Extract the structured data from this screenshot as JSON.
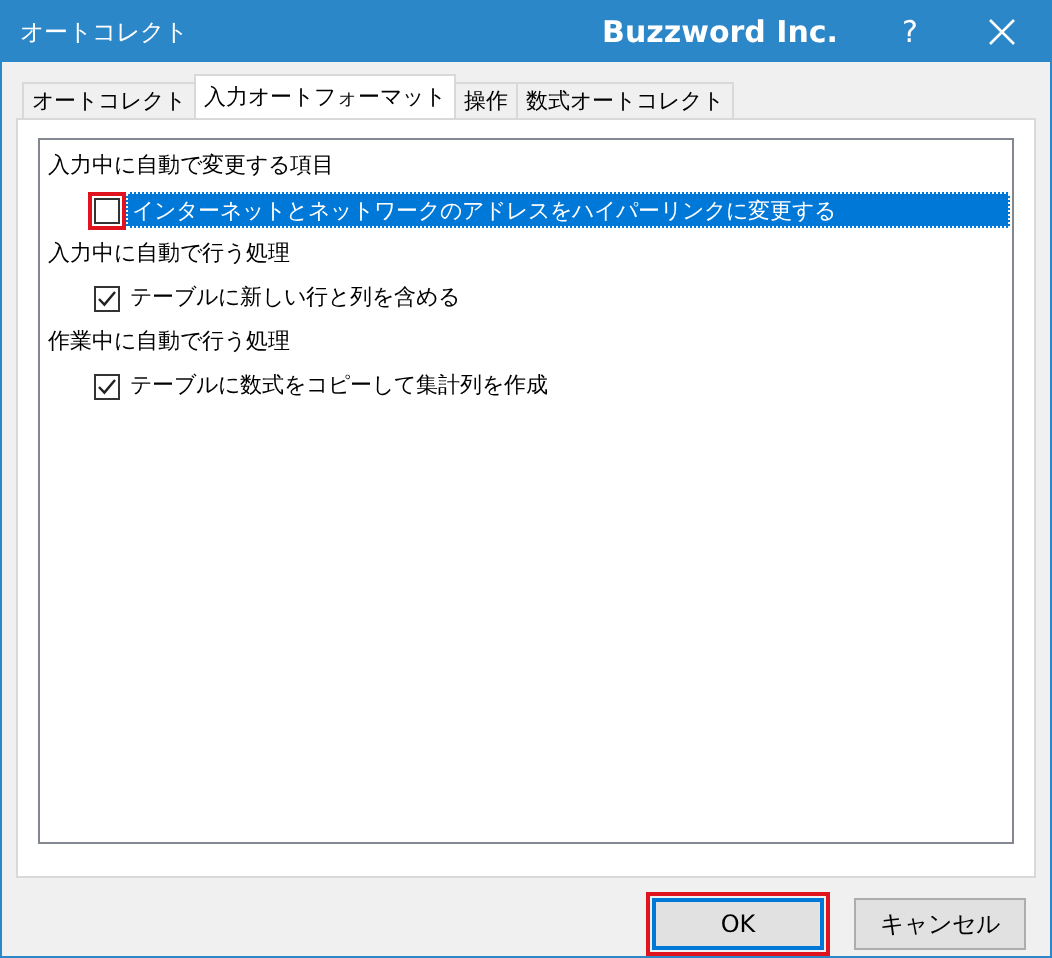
{
  "window": {
    "title": "オートコレクト",
    "brand": "Buzzword Inc.",
    "help": "?"
  },
  "tabs": [
    {
      "label": "オートコレクト",
      "selected": false
    },
    {
      "label": "入力オートフォーマット",
      "selected": true
    },
    {
      "label": "操作",
      "selected": false
    },
    {
      "label": "数式オートコレクト",
      "selected": false
    }
  ],
  "groups": [
    {
      "heading": "入力中に自動で変更する項目",
      "options": [
        {
          "label": "インターネットとネットワークのアドレスをハイパーリンクに変更する",
          "checked": false,
          "selected": true,
          "highlighted": true
        }
      ]
    },
    {
      "heading": "入力中に自動で行う処理",
      "options": [
        {
          "label": "テーブルに新しい行と列を含める",
          "checked": true,
          "selected": false,
          "highlighted": false
        }
      ]
    },
    {
      "heading": "作業中に自動で行う処理",
      "options": [
        {
          "label": "テーブルに数式をコピーして集計列を作成",
          "checked": true,
          "selected": false,
          "highlighted": false
        }
      ]
    }
  ],
  "buttons": [
    {
      "label": "OK",
      "default": true,
      "highlighted": true
    },
    {
      "label": "キャンセル",
      "default": false,
      "highlighted": false
    }
  ]
}
